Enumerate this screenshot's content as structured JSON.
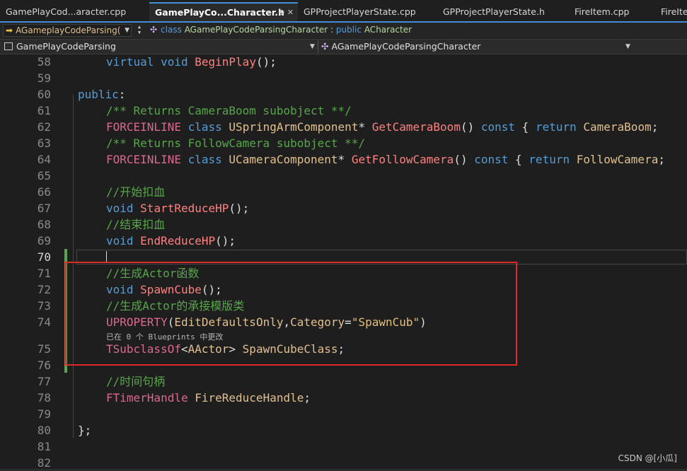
{
  "tabs": [
    {
      "label": "GamePlayCod...aracter.cpp",
      "active": false
    },
    {
      "label": "GamePlayCo...Character.h",
      "active": true
    },
    {
      "label": "GPProjectPlayerState.cpp",
      "active": false
    },
    {
      "label": "GPProjectPlayerState.h",
      "active": false
    },
    {
      "label": "FireItem.cpp",
      "active": false
    },
    {
      "label": "FireIte",
      "active": false
    }
  ],
  "nav": {
    "class_selector": "AGameplayCodeParsing(",
    "declaration_keyword": "class",
    "declaration_name": "AGamePlayCodeParsingCharacter",
    "declaration_rest": " : public ",
    "base_keyword": "public",
    "base_class": "ACharacter"
  },
  "scope": {
    "project": "GamePlayCodeParsing",
    "member": "AGamePlayCodeParsingCharacter"
  },
  "lines": [
    {
      "num": "58",
      "indent": true,
      "tokens": [
        {
          "t": "virtual",
          "c": "kw"
        },
        {
          "t": " "
        },
        {
          "t": "void",
          "c": "kw"
        },
        {
          "t": " "
        },
        {
          "t": "BeginPlay",
          "c": "fn"
        },
        {
          "t": "();"
        }
      ]
    },
    {
      "num": "59",
      "tokens": []
    },
    {
      "num": "60",
      "indent": false,
      "tokens": [
        {
          "t": "public",
          "c": "kw"
        },
        {
          "t": ":"
        }
      ]
    },
    {
      "num": "61",
      "indent": true,
      "tokens": [
        {
          "t": "/** Returns CameraBoom subobject **/",
          "c": "cm"
        }
      ]
    },
    {
      "num": "62",
      "indent": true,
      "tokens": [
        {
          "t": "FORCEINLINE",
          "c": "mac"
        },
        {
          "t": " "
        },
        {
          "t": "class",
          "c": "kw"
        },
        {
          "t": " "
        },
        {
          "t": "USpringArmComponent",
          "c": "ty"
        },
        {
          "t": "* "
        },
        {
          "t": "GetCameraBoom",
          "c": "fn"
        },
        {
          "t": "() "
        },
        {
          "t": "const",
          "c": "kw"
        },
        {
          "t": " { "
        },
        {
          "t": "return",
          "c": "kw"
        },
        {
          "t": " "
        },
        {
          "t": "CameraBoom",
          "c": "en"
        },
        {
          "t": ";"
        }
      ]
    },
    {
      "num": "63",
      "indent": true,
      "tokens": [
        {
          "t": "/** Returns FollowCamera subobject **/",
          "c": "cm"
        }
      ]
    },
    {
      "num": "64",
      "indent": true,
      "tokens": [
        {
          "t": "FORCEINLINE",
          "c": "mac"
        },
        {
          "t": " "
        },
        {
          "t": "class",
          "c": "kw"
        },
        {
          "t": " "
        },
        {
          "t": "UCameraComponent",
          "c": "ty"
        },
        {
          "t": "* "
        },
        {
          "t": "GetFollowCamera",
          "c": "fn"
        },
        {
          "t": "() "
        },
        {
          "t": "const",
          "c": "kw"
        },
        {
          "t": " { "
        },
        {
          "t": "return",
          "c": "kw"
        },
        {
          "t": " "
        },
        {
          "t": "FollowCamera",
          "c": "en"
        },
        {
          "t": ";"
        }
      ]
    },
    {
      "num": "65",
      "tokens": []
    },
    {
      "num": "66",
      "indent": true,
      "tokens": [
        {
          "t": "//开始扣血",
          "c": "cm"
        }
      ]
    },
    {
      "num": "67",
      "indent": true,
      "tokens": [
        {
          "t": "void",
          "c": "kw"
        },
        {
          "t": " "
        },
        {
          "t": "StartReduceHP",
          "c": "fn"
        },
        {
          "t": "();"
        }
      ]
    },
    {
      "num": "68",
      "indent": true,
      "tokens": [
        {
          "t": "//结束扣血",
          "c": "cm"
        }
      ]
    },
    {
      "num": "69",
      "indent": true,
      "tokens": [
        {
          "t": "void",
          "c": "kw"
        },
        {
          "t": " "
        },
        {
          "t": "EndReduceHP",
          "c": "fn"
        },
        {
          "t": "();"
        }
      ]
    },
    {
      "num": "70",
      "current": true,
      "tokens": []
    },
    {
      "num": "71",
      "indent": true,
      "tokens": [
        {
          "t": "//生成Actor函数",
          "c": "cm"
        }
      ]
    },
    {
      "num": "72",
      "indent": true,
      "tokens": [
        {
          "t": "void",
          "c": "kw"
        },
        {
          "t": " "
        },
        {
          "t": "SpawnCube",
          "c": "fn"
        },
        {
          "t": "();"
        }
      ]
    },
    {
      "num": "73",
      "indent": true,
      "tokens": [
        {
          "t": "//生成Actor的承接模版类",
          "c": "cm"
        }
      ]
    },
    {
      "num": "74",
      "indent": true,
      "tokens": [
        {
          "t": "UPROPERTY",
          "c": "mac"
        },
        {
          "t": "("
        },
        {
          "t": "EditDefaultsOnly",
          "c": "ty"
        },
        {
          "t": ","
        },
        {
          "t": "Category",
          "c": "ty"
        },
        {
          "t": "="
        },
        {
          "t": "\"SpawnCub\"",
          "c": "str"
        },
        {
          "t": ")"
        }
      ]
    },
    {
      "num": "75",
      "indent": true,
      "tokens": [
        {
          "t": "TSubclassOf",
          "c": "mac"
        },
        {
          "t": "<"
        },
        {
          "t": "AActor",
          "c": "ty"
        },
        {
          "t": "> "
        },
        {
          "t": "SpawnCubeClass",
          "c": "en"
        },
        {
          "t": ";"
        }
      ]
    },
    {
      "num": "76",
      "tokens": []
    },
    {
      "num": "77",
      "indent": true,
      "tokens": [
        {
          "t": "//时间句柄",
          "c": "cm"
        }
      ]
    },
    {
      "num": "78",
      "indent": true,
      "tokens": [
        {
          "t": "FTimerHandle",
          "c": "mac"
        },
        {
          "t": " "
        },
        {
          "t": "FireReduceHandle",
          "c": "en"
        },
        {
          "t": ";"
        }
      ]
    },
    {
      "num": "79",
      "tokens": []
    },
    {
      "num": "80",
      "indent": false,
      "tokens": [
        {
          "t": "};"
        }
      ]
    },
    {
      "num": "81",
      "tokens": []
    },
    {
      "num": "82",
      "tokens": []
    }
  ],
  "hint_text": "已在 0 个 Blueprints 中更改",
  "watermark": "CSDN @[小瓜]"
}
